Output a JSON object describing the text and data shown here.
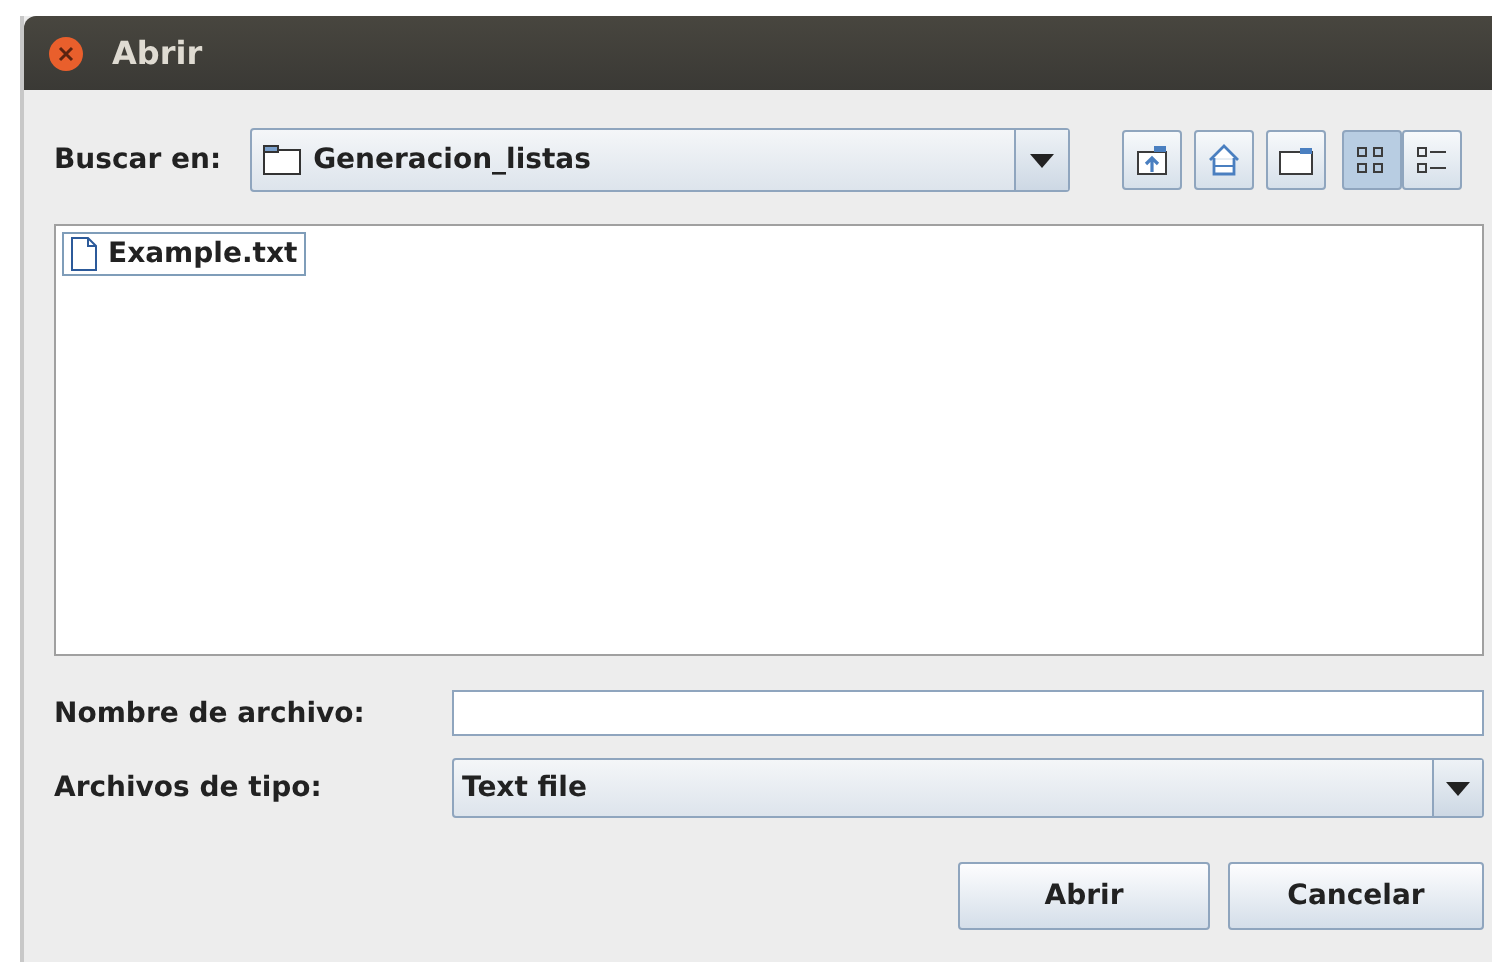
{
  "window": {
    "title": "Abrir"
  },
  "look_in": {
    "label": "Buscar en:",
    "value": "Generacion_listas"
  },
  "toolbar": [
    {
      "kind": "up",
      "selected": false
    },
    {
      "kind": "home",
      "selected": false
    },
    {
      "kind": "new-folder",
      "selected": false
    },
    {
      "kind": "list-view",
      "selected": true
    },
    {
      "kind": "details-view",
      "selected": false
    }
  ],
  "files": [
    {
      "name": "Example.txt",
      "selected": true
    }
  ],
  "file_name": {
    "label": "Nombre de archivo:"
  },
  "file_type": {
    "label": "Archivos de tipo:",
    "value": "Text file"
  },
  "buttons": [
    "Abrir",
    "Cancelar"
  ]
}
